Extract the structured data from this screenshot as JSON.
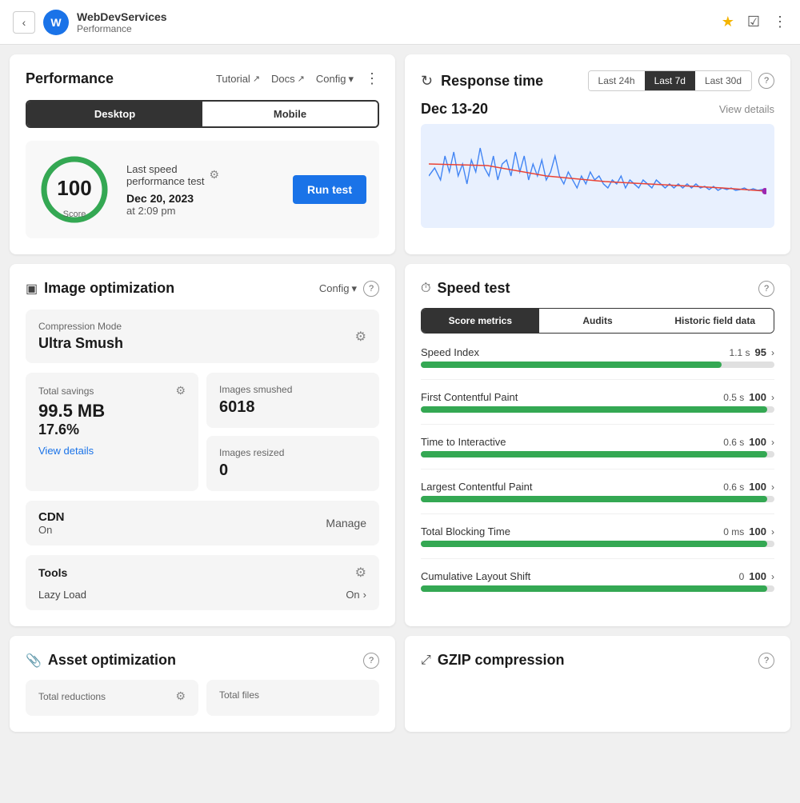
{
  "topbar": {
    "back_label": "‹",
    "site_name": "WebDevServices",
    "site_sub": "Performance",
    "star_icon": "★",
    "wp_icon": "W",
    "more_icon": "⋮"
  },
  "performance": {
    "title": "Performance",
    "tutorial_label": "Tutorial",
    "docs_label": "Docs",
    "config_label": "Config",
    "more_icon": "⋮",
    "desktop_label": "Desktop",
    "mobile_label": "Mobile",
    "score": "100",
    "score_label": "Score",
    "last_speed_label": "Last speed",
    "performance_test_label": "performance test",
    "test_date": "Dec 20, 2023",
    "test_time": "at 2:09 pm",
    "run_test_label": "Run test"
  },
  "response_time": {
    "title": "Response time",
    "icon": "↻",
    "filter_24h": "Last 24h",
    "filter_7d": "Last 7d",
    "filter_30d": "Last 30d",
    "date_range": "Dec 13-20",
    "view_details": "View details"
  },
  "image_optimization": {
    "title": "Image optimization",
    "config_label": "Config",
    "icon": "⊞",
    "compression_label": "Compression Mode",
    "compression_value": "Ultra Smush",
    "total_savings_label": "Total savings",
    "savings_mb": "99.5 MB",
    "savings_pct": "17.6%",
    "view_details": "View details",
    "images_smushed_label": "Images smushed",
    "images_smushed_value": "6018",
    "images_resized_label": "Images resized",
    "images_resized_value": "0",
    "cdn_title": "CDN",
    "cdn_status": "On",
    "manage_label": "Manage",
    "tools_title": "Tools",
    "lazy_load_label": "Lazy Load",
    "lazy_load_status": "On"
  },
  "speed_test": {
    "title": "Speed test",
    "tabs": [
      "Score metrics",
      "Audits",
      "Historic field data"
    ],
    "metrics": [
      {
        "name": "Speed Index",
        "score": 95,
        "time": "1.1 s",
        "bar_pct": 85
      },
      {
        "name": "First Contentful Paint",
        "score": 100,
        "time": "0.5 s",
        "bar_pct": 98
      },
      {
        "name": "Time to Interactive",
        "score": 100,
        "time": "0.6 s",
        "bar_pct": 98
      },
      {
        "name": "Largest Contentful Paint",
        "score": 100,
        "time": "0.6 s",
        "bar_pct": 98
      },
      {
        "name": "Total Blocking Time",
        "score": 100,
        "time": "0 ms",
        "bar_pct": 98
      },
      {
        "name": "Cumulative Layout Shift",
        "score": 100,
        "time": "0",
        "bar_pct": 98
      }
    ]
  },
  "asset_optimization": {
    "title": "Asset optimization",
    "icon": "🔗",
    "total_reductions_label": "Total reductions",
    "total_files_label": "Total files"
  },
  "gzip": {
    "title": "GZIP compression",
    "icon": "⤢"
  }
}
